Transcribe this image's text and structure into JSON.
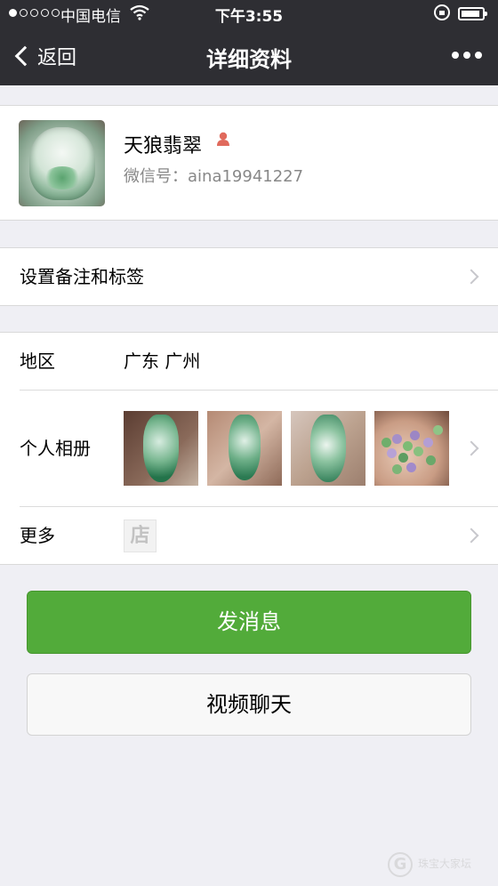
{
  "status_bar": {
    "carrier": "中国电信",
    "time": "下午3:55"
  },
  "nav": {
    "back_label": "返回",
    "title": "详细资料"
  },
  "profile": {
    "name": "天狼翡翠",
    "wechat_label": "微信号：",
    "wechat_id": "aina19941227",
    "gender_icon": "female-icon",
    "gender_color": "#e06a5c"
  },
  "remark": {
    "label": "设置备注和标签"
  },
  "region": {
    "label": "地区",
    "value": "广东 广州"
  },
  "album": {
    "label": "个人相册",
    "photos": [
      "jade-pendant-photo",
      "jade-pendant-photo",
      "jade-pendant-photo",
      "jade-beads-photo"
    ]
  },
  "more": {
    "label": "更多",
    "shop_icon_text": "店"
  },
  "actions": {
    "send_message": "发消息",
    "video_chat": "视频聊天",
    "primary_color": "#52ab3a"
  },
  "watermark": {
    "logo_letter": "G",
    "text": "珠宝大家坛"
  }
}
